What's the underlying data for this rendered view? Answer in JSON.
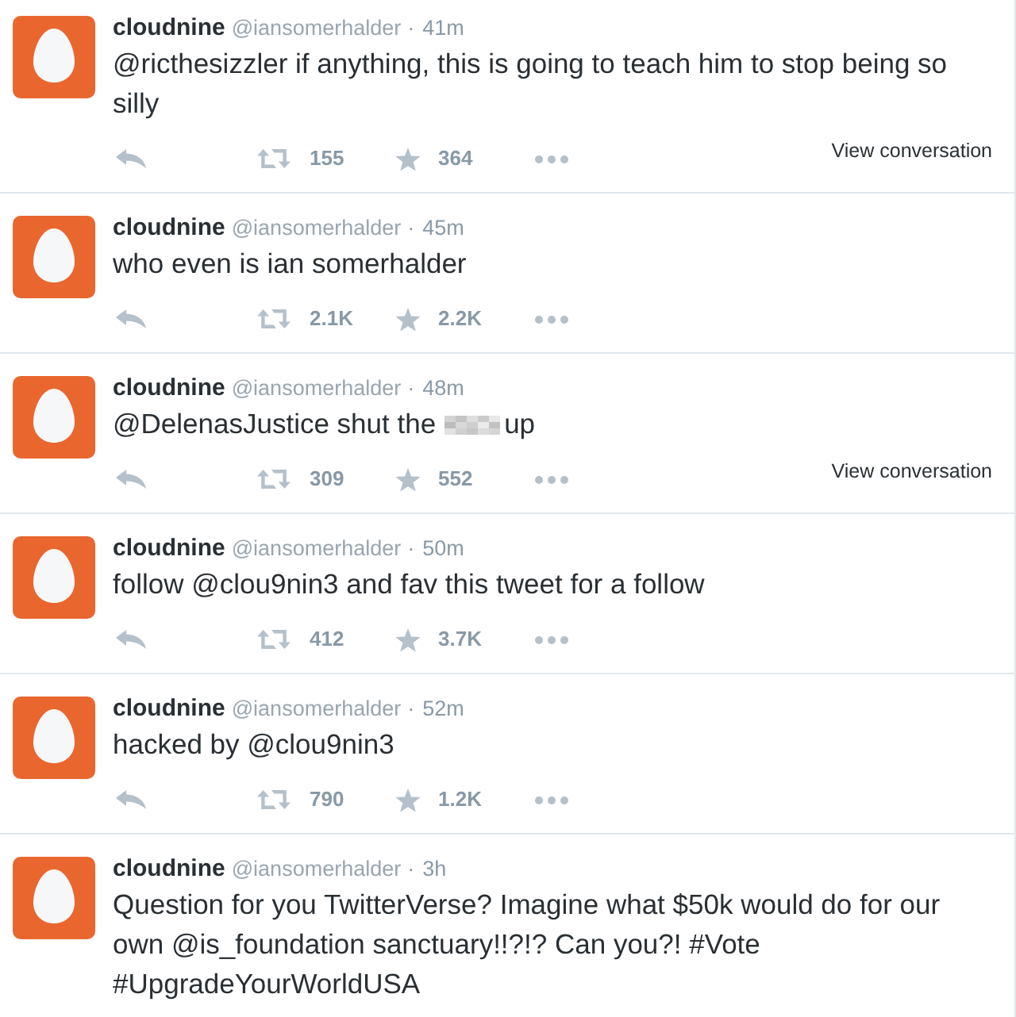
{
  "tweets": [
    {
      "name": "cloudnine",
      "handle": "@iansomerhalder",
      "separator": "·",
      "time": "41m",
      "text": [
        {
          "kind": "text",
          "value": "@ricthesizzler if anything, this is going to teach him to stop being so silly"
        }
      ],
      "retweets": "155",
      "favorites": "364",
      "view_conversation": "View conversation"
    },
    {
      "name": "cloudnine",
      "handle": "@iansomerhalder",
      "separator": "·",
      "time": "45m",
      "text": [
        {
          "kind": "text",
          "value": "who even is ian somerhalder"
        }
      ],
      "retweets": "2.1K",
      "favorites": "2.2K"
    },
    {
      "name": "cloudnine",
      "handle": "@iansomerhalder",
      "separator": "·",
      "time": "48m",
      "text": [
        {
          "kind": "text",
          "value": "@DelenasJustice shut the"
        },
        {
          "kind": "pixelated"
        },
        {
          "kind": "text",
          "value": "up"
        }
      ],
      "retweets": "309",
      "favorites": "552",
      "view_conversation": "View conversation"
    },
    {
      "name": "cloudnine",
      "handle": "@iansomerhalder",
      "separator": "·",
      "time": "50m",
      "text": [
        {
          "kind": "text",
          "value": "follow @clou9nin3 and fav this tweet for a follow"
        }
      ],
      "retweets": "412",
      "favorites": "3.7K"
    },
    {
      "name": "cloudnine",
      "handle": "@iansomerhalder",
      "separator": "·",
      "time": "52m",
      "text": [
        {
          "kind": "text",
          "value": "hacked by @clou9nin3"
        }
      ],
      "retweets": "790",
      "favorites": "1.2K"
    },
    {
      "name": "cloudnine",
      "handle": "@iansomerhalder",
      "separator": "·",
      "time": "3h",
      "text": [
        {
          "kind": "text",
          "value": "Question for you TwitterVerse? Imagine what $50k would do for our own @is_foundation sanctuary!!?!? Can you?! #Vote #UpgradeYourWorldUSA"
        }
      ]
    }
  ]
}
